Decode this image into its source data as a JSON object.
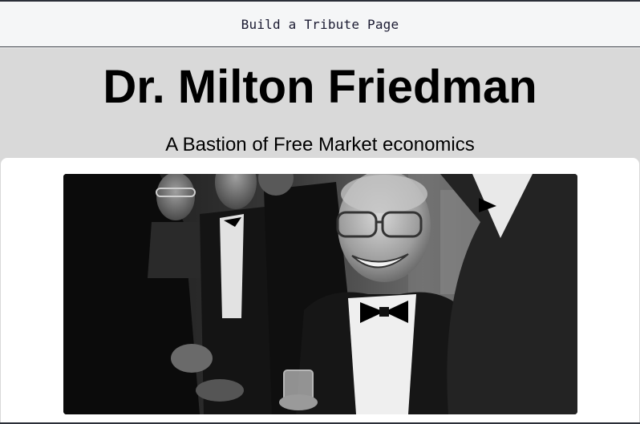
{
  "header": {
    "title": "Build a Tribute Page"
  },
  "tribute": {
    "title": "Dr. Milton Friedman",
    "subtitle": "A Bastion of Free Market economics"
  }
}
